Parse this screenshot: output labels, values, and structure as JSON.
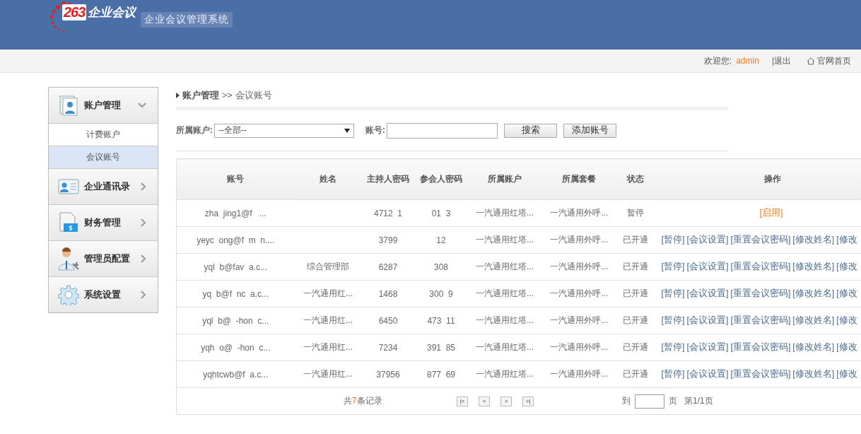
{
  "header": {
    "logo": {
      "number": "263",
      "name": "企业会议"
    },
    "system_name": "企业会议管理系统"
  },
  "top_bar": {
    "welcome": "欢迎您:",
    "user": "admin",
    "logout": "|退出",
    "home": "官网首页"
  },
  "sidebar": {
    "groups": [
      {
        "label": "账户管理",
        "expanded": true,
        "children": [
          {
            "label": "计费账户",
            "selected": false
          },
          {
            "label": "会议账号",
            "selected": true
          }
        ]
      },
      {
        "label": "企业通讯录",
        "expanded": false
      },
      {
        "label": "财务管理",
        "expanded": false
      },
      {
        "label": "管理员配置",
        "expanded": false
      },
      {
        "label": "系统设置",
        "expanded": false
      }
    ]
  },
  "breadcrumb": {
    "section": "账户管理",
    "separator": ">>",
    "page": "会议账号"
  },
  "filter": {
    "account_label": "所属账户:",
    "account_value": "--全部--",
    "number_label": "账号:",
    "search_button": "搜索",
    "add_button": "添加账号"
  },
  "table": {
    "columns": [
      "账号",
      "姓名",
      "主持人密码",
      "参会人密码",
      "所属账户",
      "所属套餐",
      "状态",
      "操作"
    ],
    "rows": [
      {
        "account": "zha  jing1@f   ...",
        "name": "",
        "host_pw": "4712  1",
        "guest_pw": "01  3",
        "owner": "一汽通用红塔...",
        "plan": "一汽通用外呼...",
        "status": "暂停",
        "actions": [
          {
            "label": "[启用]",
            "kind": "enable"
          }
        ]
      },
      {
        "account": "yeyc  ong@f  m  n....",
        "name": "",
        "host_pw": "3799",
        "guest_pw": "12",
        "owner": "一汽通用红塔...",
        "plan": "一汽通用外呼...",
        "status": "已开通",
        "actions": [
          {
            "label": "[暂停]",
            "kind": "link"
          },
          {
            "label": "[会议设置]",
            "kind": "link"
          },
          {
            "label": "[重置会议密码]",
            "kind": "link"
          },
          {
            "label": "[修改姓名]",
            "kind": "link"
          },
          {
            "label": "[修改",
            "kind": "link"
          }
        ]
      },
      {
        "account": "yql  b@fav  a.c...",
        "name": "综合管理部",
        "host_pw": "6287",
        "guest_pw": "308",
        "owner": "一汽通用红塔...",
        "plan": "一汽通用外呼...",
        "status": "已开通",
        "actions": [
          {
            "label": "[暂停]",
            "kind": "link"
          },
          {
            "label": "[会议设置]",
            "kind": "link"
          },
          {
            "label": "[重置会议密码]",
            "kind": "link"
          },
          {
            "label": "[修改姓名]",
            "kind": "link"
          },
          {
            "label": "[修改",
            "kind": "link"
          }
        ]
      },
      {
        "account": "yq  b@f  nc  a.c...",
        "name": "一汽通用红...",
        "host_pw": "1468",
        "guest_pw": "300  9",
        "owner": "一汽通用红塔...",
        "plan": "一汽通用外呼...",
        "status": "已开通",
        "actions": [
          {
            "label": "[暂停]",
            "kind": "link"
          },
          {
            "label": "[会议设置]",
            "kind": "link"
          },
          {
            "label": "[重置会议密码]",
            "kind": "link"
          },
          {
            "label": "[修改姓名]",
            "kind": "link"
          },
          {
            "label": "[修改",
            "kind": "link"
          }
        ]
      },
      {
        "account": "yql  b@  -hon  c...",
        "name": "一汽通用红...",
        "host_pw": "6450",
        "guest_pw": "473  11",
        "owner": "一汽通用红塔...",
        "plan": "一汽通用外呼...",
        "status": "已开通",
        "actions": [
          {
            "label": "[暂停]",
            "kind": "link"
          },
          {
            "label": "[会议设置]",
            "kind": "link"
          },
          {
            "label": "[重置会议密码]",
            "kind": "link"
          },
          {
            "label": "[修改姓名]",
            "kind": "link"
          },
          {
            "label": "[修改",
            "kind": "link"
          }
        ]
      },
      {
        "account": "yqh  o@  -hon  c...",
        "name": "一汽通用红...",
        "host_pw": "7234",
        "guest_pw": "391  85",
        "owner": "一汽通用红塔...",
        "plan": "一汽通用外呼...",
        "status": "已开通",
        "actions": [
          {
            "label": "[暂停]",
            "kind": "link"
          },
          {
            "label": "[会议设置]",
            "kind": "link"
          },
          {
            "label": "[重置会议密码]",
            "kind": "link"
          },
          {
            "label": "[修改姓名]",
            "kind": "link"
          },
          {
            "label": "[修改",
            "kind": "link"
          }
        ]
      },
      {
        "account": "yqhtcwb@f  a.c...",
        "name": "一汽通用红...",
        "host_pw": "37956",
        "guest_pw": "877  69",
        "owner": "一汽通用红塔...",
        "plan": "一汽通用外呼...",
        "status": "已开通",
        "actions": [
          {
            "label": "[暂停]",
            "kind": "link"
          },
          {
            "label": "[会议设置]",
            "kind": "link"
          },
          {
            "label": "[重置会议密码]",
            "kind": "link"
          },
          {
            "label": "[修改姓名]",
            "kind": "link"
          },
          {
            "label": "[修改",
            "kind": "link"
          }
        ]
      }
    ]
  },
  "pagination": {
    "total_prefix": "共",
    "total_count": "7",
    "total_suffix": "条记录",
    "first": "|<",
    "prev": "<",
    "next": ">",
    "last": ">|",
    "goto_label": "到",
    "page_unit": "页",
    "page_info": "第1/1页"
  }
}
